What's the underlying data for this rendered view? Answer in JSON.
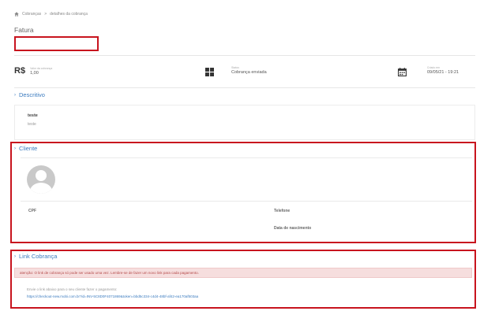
{
  "breadcrumb": {
    "items": [
      "Cobranças",
      "detalhes da cobrança"
    ],
    "separator": ">"
  },
  "page": {
    "title": "Fatura"
  },
  "summary": {
    "value": {
      "icon_text": "R$",
      "label": "Valor da cobrança",
      "value": "1,00"
    },
    "status": {
      "label": "Status",
      "value": "Cobrança enviada"
    },
    "created": {
      "label": "Criado em",
      "value": "09/05/21 - 19:21"
    }
  },
  "description": {
    "heading": "Descritivo",
    "title": "teste",
    "body": "teste"
  },
  "client": {
    "heading": "Cliente",
    "fields": {
      "cpf": "CPF",
      "phone": "Telefone",
      "birth": "Data de nascimento"
    }
  },
  "link": {
    "heading": "Link Cobrança",
    "alert": "atenção: O link de cobrança só pode ser usado uma vez. Lembre-se de fazer um novo link para cada pagamento.",
    "instruction": "Envie o link abaixo para o seu cliente fazer o pagamento:",
    "url": "https://checkout-new.mobi.com.br?id=INV-5C8D0F4071869&token=bbd5c334-c4d4-48bf-af42-ea170af503aa"
  },
  "colors": {
    "accent": "#3b7bbf",
    "highlight": "#c8141e",
    "alert_bg": "#f6dede",
    "alert_text": "#b54a4a"
  },
  "icons": {
    "home": "home-icon",
    "status": "grid-icon",
    "calendar": "calendar-icon",
    "chevron": "chevron-right-icon",
    "avatar": "user-avatar-icon"
  }
}
